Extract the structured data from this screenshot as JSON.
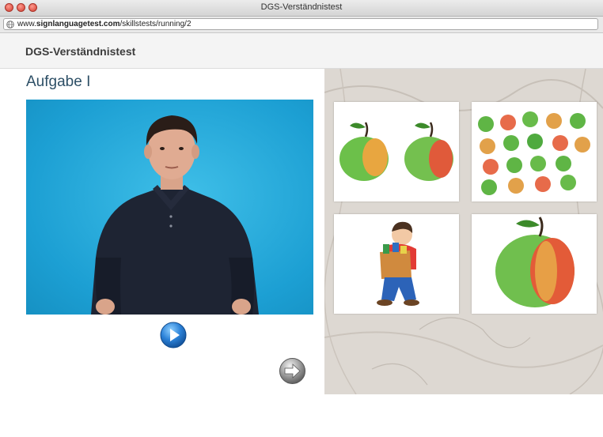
{
  "window": {
    "title": "DGS-Verständnistest",
    "url_prefix": "www.",
    "url_domain": "signlanguagetest.com",
    "url_path": "/skillstests/running/2"
  },
  "app": {
    "name": "DGS-Verständnistest"
  },
  "task": {
    "heading": "Aufgabe I",
    "video_icon": "signer-video",
    "play_icon": "play-icon",
    "next_icon": "next-arrow-icon"
  },
  "answers": [
    {
      "icon": "two-apples"
    },
    {
      "icon": "many-apples"
    },
    {
      "icon": "boy-carrying-bag"
    },
    {
      "icon": "one-big-apple"
    }
  ],
  "colors": {
    "heading": "#2d4f66",
    "video_bg": "#1c9fd3",
    "button_blue": "#1f6fc4"
  }
}
